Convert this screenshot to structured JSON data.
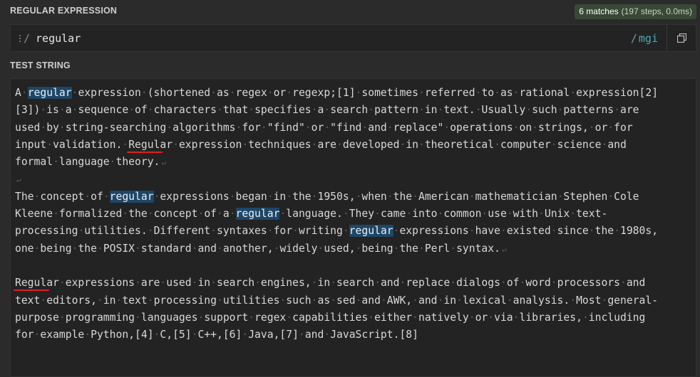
{
  "regex_section": {
    "label": "REGULAR EXPRESSION",
    "delimiter_open": "/",
    "pattern": "regular",
    "delimiter_close": "/",
    "flags": "mgi",
    "copy_icon": "copy-icon",
    "grip_icon": "drag-handle-icon"
  },
  "match_info": {
    "count": "6 matches",
    "meta": "(197 steps, 0.0ms)"
  },
  "test_section": {
    "label": "TEST STRING",
    "lines": [
      [
        {
          "t": "A "
        },
        {
          "t": "regular",
          "m": true
        },
        {
          "t": " expression (shortened as regex or regexp;[1] sometimes referred to as rational expression[2]"
        }
      ],
      [
        {
          "t": "[3]) is a sequence of characters that specifies a search pattern in text. Usually such patterns are"
        }
      ],
      [
        {
          "t": "used by string-searching algorithms for \"find\" or \"find and replace\" operations on strings, or for"
        }
      ],
      [
        {
          "t": "input validation. "
        },
        {
          "t": "Regular",
          "u": true
        },
        {
          "t": " expression techniques are developed in theoretical computer science and"
        }
      ],
      [
        {
          "t": "formal language theory."
        }
      ],
      [
        {
          "t": ""
        }
      ],
      [
        {
          "t": "The concept of "
        },
        {
          "t": "regular",
          "m": true
        },
        {
          "t": " expressions began in the 1950s, when the American mathematician Stephen Cole"
        }
      ],
      [
        {
          "t": "Kleene formalized the concept of a "
        },
        {
          "t": "regular",
          "m": true
        },
        {
          "t": " language. They came into common use with Unix text-"
        }
      ],
      [
        {
          "t": "processing utilities. Different syntaxes for writing "
        },
        {
          "t": "regular",
          "m": true
        },
        {
          "t": " expressions have existed since the 1980s,"
        }
      ],
      [
        {
          "t": "one being the POSIX standard and another, widely used, being the Perl syntax."
        }
      ],
      [
        {
          "t": ""
        }
      ],
      [
        {
          "t": "Regular",
          "u": true
        },
        {
          "t": " expressions are used in search engines, in search and replace dialogs of word processors and"
        }
      ],
      [
        {
          "t": "text editors, in text processing utilities such as sed and AWK, and in lexical analysis. Most general-"
        }
      ],
      [
        {
          "t": "purpose programming languages support regex capabilities either natively or via libraries, including"
        }
      ],
      [
        {
          "t": "for example Python,[4] C,[5] C++,[6] Java,[7] and JavaScript.[8]"
        }
      ]
    ],
    "line_end_after": [
      4,
      5,
      9
    ]
  },
  "colors": {
    "background": "#2b2b2b",
    "editor_bg": "#232323",
    "match_highlight": "#1e4666",
    "badge_bg": "#384a35",
    "flags": "#4fa7b8",
    "error_underline": "#e02020"
  }
}
